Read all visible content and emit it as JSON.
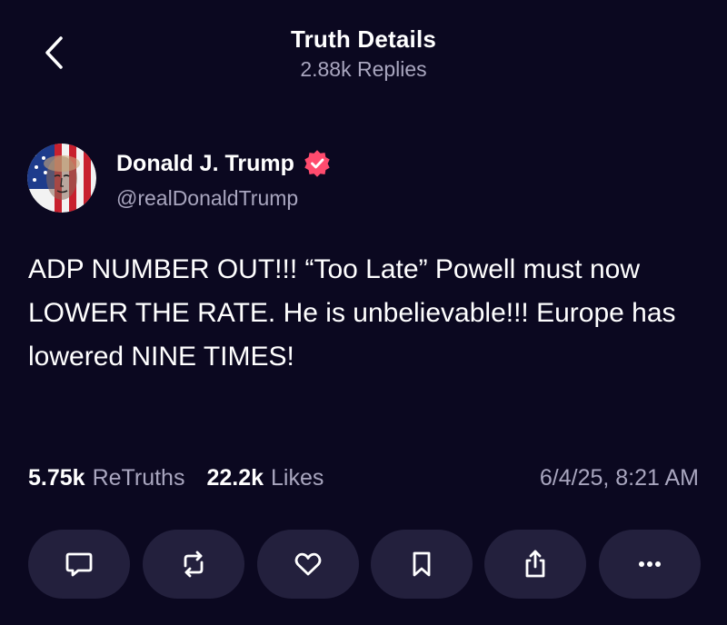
{
  "header": {
    "back_icon": "chevron-left-icon",
    "title": "Truth Details",
    "subtitle": "2.88k Replies"
  },
  "author": {
    "name": "Donald J. Trump",
    "handle": "@realDonaldTrump",
    "verified": true,
    "verified_color": "#ff4b6e"
  },
  "post": {
    "text": "ADP NUMBER OUT!!! “Too Late” Powell must now LOWER THE RATE. He is unbelievable!!! Europe has lowered NINE TIMES!"
  },
  "stats": {
    "retruths_count": "5.75k",
    "retruths_label": "ReTruths",
    "likes_count": "22.2k",
    "likes_label": "Likes",
    "timestamp": "6/4/25, 8:21 AM"
  },
  "actions": [
    {
      "name": "reply",
      "icon": "comment-icon"
    },
    {
      "name": "retruth",
      "icon": "repost-icon"
    },
    {
      "name": "like",
      "icon": "heart-icon"
    },
    {
      "name": "bookmark",
      "icon": "bookmark-icon"
    },
    {
      "name": "share",
      "icon": "share-icon"
    },
    {
      "name": "more",
      "icon": "more-icon"
    }
  ],
  "colors": {
    "background": "#0b0820",
    "button_bg": "#23203d",
    "secondary_text": "#a9a6bf",
    "primary_text": "#ffffff"
  }
}
